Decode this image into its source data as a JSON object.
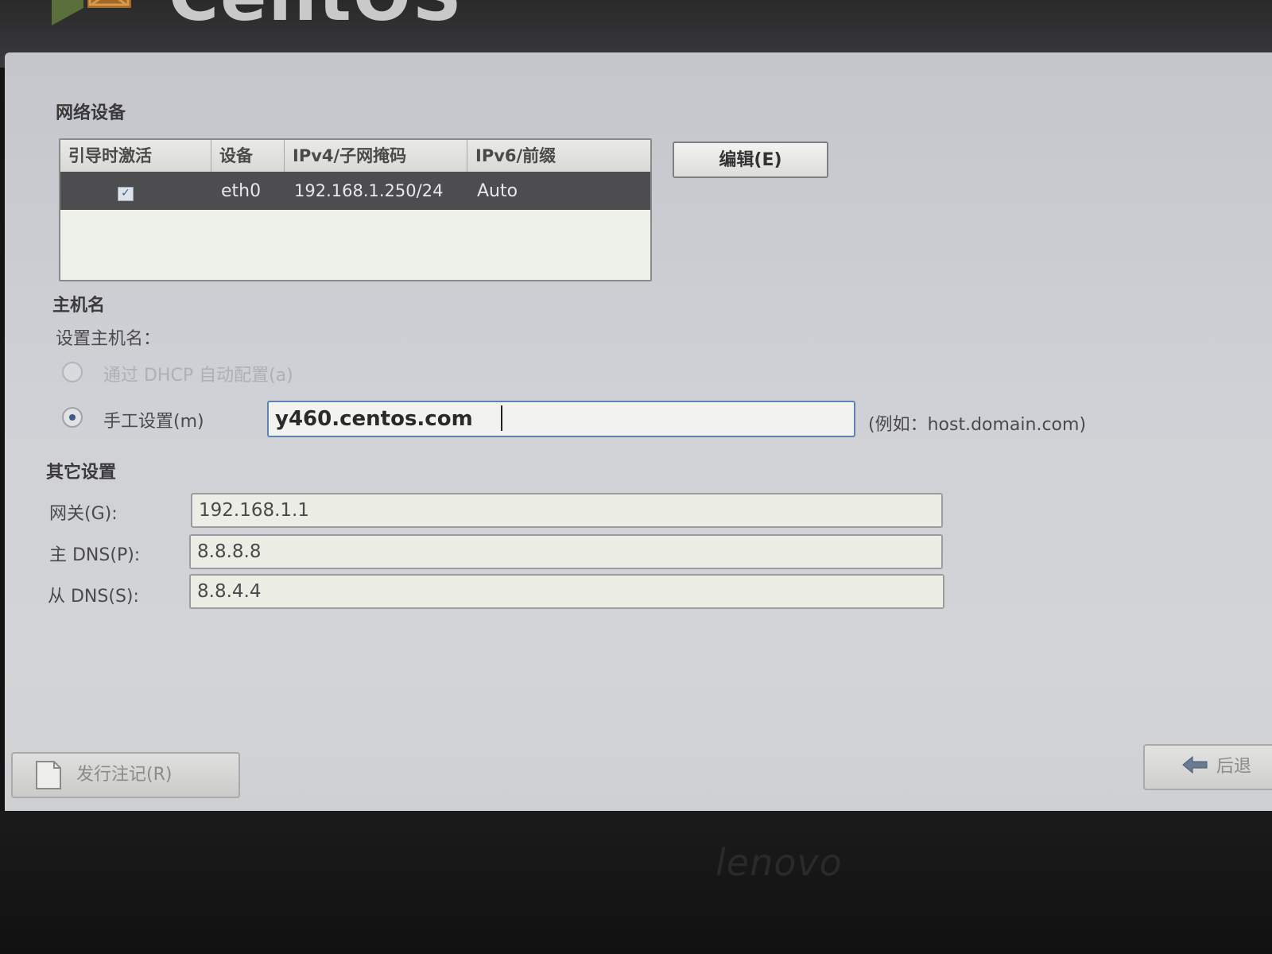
{
  "branding": {
    "os_logo_text": "CentOS",
    "laptop_brand": "lenovo"
  },
  "network_devices": {
    "section_title": "网络设备",
    "columns": [
      "引导时激活",
      "设备",
      "IPv4/子网掩码",
      "IPv6/前缀"
    ],
    "rows": [
      {
        "active_on_boot": true,
        "device": "eth0",
        "ipv4": "192.168.1.250/24",
        "ipv6": "Auto"
      }
    ],
    "edit_button_label": "编辑(E)"
  },
  "hostname": {
    "section_title": "主机名",
    "prompt": "设置主机名：",
    "dhcp_option_label": "通过 DHCP 自动配置(a)",
    "manual_option_label": "手工设置(m)",
    "selected_option": "manual",
    "value": "y460.centos.com",
    "example_hint": "(例如：host.domain.com)"
  },
  "other_settings": {
    "section_title": "其它设置",
    "gateway_label": "网关(G):",
    "gateway_value": "192.168.1.1",
    "primary_dns_label": "主 DNS(P):",
    "primary_dns_value": "8.8.8.8",
    "secondary_dns_label": "从 DNS(S):",
    "secondary_dns_value": "8.8.4.4"
  },
  "footer": {
    "release_notes_label": "发行注记(R)",
    "back_label": "后退"
  },
  "colors": {
    "selected_row": "#4d4d4f",
    "focus_border": "#5f82b6",
    "screen_background": "#cfd1d6"
  },
  "icons": {
    "release_notes": "document-icon",
    "back": "back-arrow-icon",
    "logo": "centos-logo-icon"
  }
}
